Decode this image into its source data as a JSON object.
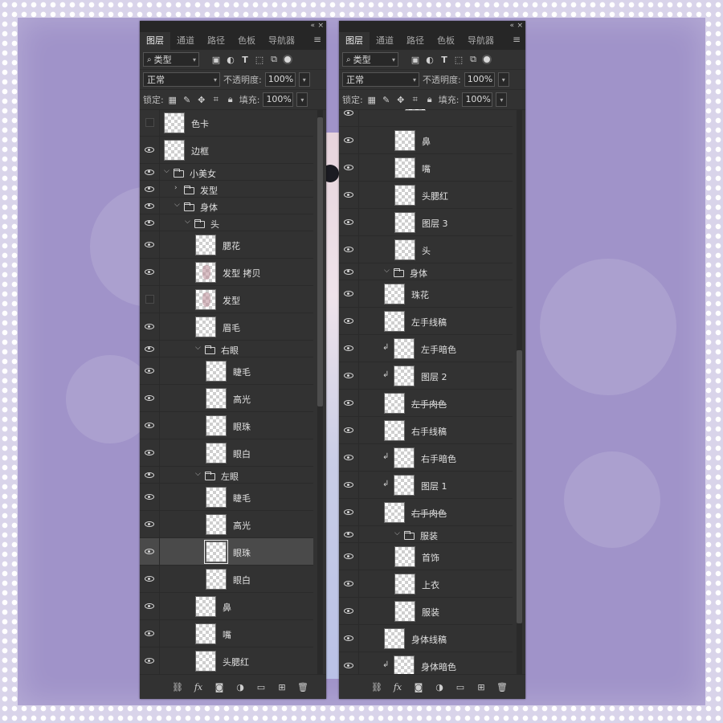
{
  "panel_tabs": [
    "图层",
    "通道",
    "路径",
    "色板",
    "导航器"
  ],
  "filter": {
    "kind_label": "类型"
  },
  "blend": {
    "mode": "正常",
    "opacity_label": "不透明度:",
    "opacity_value": "100%"
  },
  "lock": {
    "label": "锁定:",
    "fill_label": "填充:",
    "fill_value": "100%"
  },
  "left_layers": [
    {
      "name": "色卡",
      "type": "layer",
      "indent": 0,
      "visible": false
    },
    {
      "name": "边框",
      "type": "layer",
      "indent": 0,
      "visible": true
    },
    {
      "name": "小美女",
      "type": "group",
      "indent": 0,
      "open": true,
      "visible": true
    },
    {
      "name": "发型",
      "type": "group",
      "indent": 1,
      "open": false,
      "visible": true
    },
    {
      "name": "身体",
      "type": "group",
      "indent": 1,
      "open": true,
      "visible": true
    },
    {
      "name": "头",
      "type": "group",
      "indent": 2,
      "open": true,
      "visible": true
    },
    {
      "name": "腮花",
      "type": "layer",
      "indent": 3,
      "visible": true
    },
    {
      "name": "发型 拷贝",
      "type": "layer",
      "indent": 3,
      "visible": true,
      "thumb": "hair"
    },
    {
      "name": "发型",
      "type": "layer",
      "indent": 3,
      "visible": false,
      "thumb": "hair"
    },
    {
      "name": "眉毛",
      "type": "layer",
      "indent": 3,
      "visible": true
    },
    {
      "name": "右眼",
      "type": "group",
      "indent": 3,
      "open": true,
      "visible": true
    },
    {
      "name": "睫毛",
      "type": "layer",
      "indent": 4,
      "visible": true
    },
    {
      "name": "高光",
      "type": "layer",
      "indent": 4,
      "visible": true
    },
    {
      "name": "眼珠",
      "type": "layer",
      "indent": 4,
      "visible": true
    },
    {
      "name": "眼白",
      "type": "layer",
      "indent": 4,
      "visible": true
    },
    {
      "name": "左眼",
      "type": "group",
      "indent": 3,
      "open": true,
      "visible": true
    },
    {
      "name": "睫毛",
      "type": "layer",
      "indent": 4,
      "visible": true
    },
    {
      "name": "高光",
      "type": "layer",
      "indent": 4,
      "visible": true
    },
    {
      "name": "眼珠",
      "type": "layer",
      "indent": 4,
      "visible": true,
      "selected": true
    },
    {
      "name": "眼白",
      "type": "layer",
      "indent": 4,
      "visible": true
    },
    {
      "name": "鼻",
      "type": "layer",
      "indent": 3,
      "visible": true
    },
    {
      "name": "嘴",
      "type": "layer",
      "indent": 3,
      "visible": true
    },
    {
      "name": "头腮红",
      "type": "layer",
      "indent": 3,
      "visible": true
    }
  ],
  "right_layers": [
    {
      "name": "眼白",
      "type": "layer",
      "indent": 4,
      "visible": true,
      "partial": true
    },
    {
      "name": "鼻",
      "type": "layer",
      "indent": 3,
      "visible": true
    },
    {
      "name": "嘴",
      "type": "layer",
      "indent": 3,
      "visible": true
    },
    {
      "name": "头腮红",
      "type": "layer",
      "indent": 3,
      "visible": true
    },
    {
      "name": "图层 3",
      "type": "layer",
      "indent": 3,
      "visible": true
    },
    {
      "name": "头",
      "type": "layer",
      "indent": 3,
      "visible": true
    },
    {
      "name": "身体",
      "type": "group",
      "indent": 2,
      "open": true,
      "visible": true
    },
    {
      "name": "珠花",
      "type": "layer",
      "indent": 2,
      "visible": true
    },
    {
      "name": "左手线稿",
      "type": "layer",
      "indent": 2,
      "visible": true
    },
    {
      "name": "左手暗色",
      "type": "layer",
      "indent": 2,
      "visible": true,
      "clipped": true
    },
    {
      "name": "图层 2",
      "type": "layer",
      "indent": 2,
      "visible": true,
      "clipped": true
    },
    {
      "name": "左手肉色",
      "type": "layer",
      "indent": 2,
      "visible": true,
      "struck": true
    },
    {
      "name": "右手线稿",
      "type": "layer",
      "indent": 2,
      "visible": true
    },
    {
      "name": "右手暗色",
      "type": "layer",
      "indent": 2,
      "visible": true,
      "clipped": true
    },
    {
      "name": "图层 1",
      "type": "layer",
      "indent": 2,
      "visible": true,
      "clipped": true
    },
    {
      "name": "右手肉色",
      "type": "layer",
      "indent": 2,
      "visible": true,
      "struck": true
    },
    {
      "name": "服装",
      "type": "group",
      "indent": 3,
      "open": true,
      "visible": true
    },
    {
      "name": "首饰",
      "type": "layer",
      "indent": 3,
      "visible": true
    },
    {
      "name": "上衣",
      "type": "layer",
      "indent": 3,
      "visible": true
    },
    {
      "name": "服装",
      "type": "layer",
      "indent": 3,
      "visible": true
    },
    {
      "name": "身体线稿",
      "type": "layer",
      "indent": 2,
      "visible": true
    },
    {
      "name": "身体暗色",
      "type": "layer",
      "indent": 2,
      "visible": true,
      "clipped": true
    }
  ],
  "icons": {
    "eye": "eye-icon",
    "folder": "folder-icon",
    "link": "link-icon",
    "fx": "fx",
    "mask": "mask-icon",
    "adjustment": "adjustment-icon",
    "new_group": "folder-icon",
    "new_layer": "new-layer-icon",
    "delete": "trash-icon"
  },
  "colors": {
    "panel_bg": "#323232",
    "selected_row": "#4a4a4a",
    "background": "#a093c9"
  }
}
